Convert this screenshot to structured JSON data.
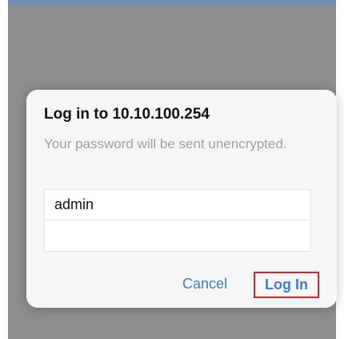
{
  "dialog": {
    "title": "Log in to 10.10.100.254",
    "message": "Your password will be sent unencrypted.",
    "username_value": "admin",
    "password_value": "",
    "cancel_label": "Cancel",
    "login_label": "Log In"
  },
  "colors": {
    "backdrop": "#8e8e8e",
    "dialog_background": "#f6f6f6",
    "button_text": "#3d7cd1",
    "highlight_box": "#d8232a"
  }
}
